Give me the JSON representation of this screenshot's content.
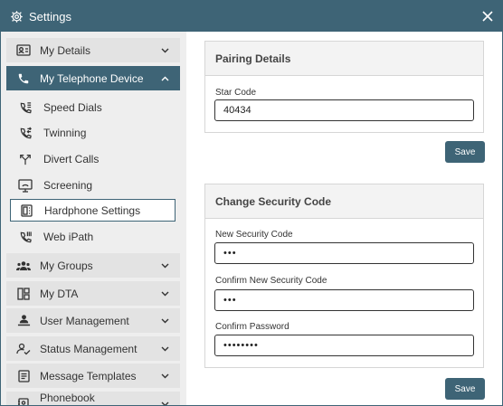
{
  "window": {
    "title": "Settings",
    "title_icon": "gear-icon",
    "close_icon": "close-icon"
  },
  "colors": {
    "accent": "#3e6476",
    "sidebar_bg": "#eeeeee",
    "nav_item_bg": "#e3e3e3",
    "panel_head_bg": "#f3f3f3"
  },
  "sidebar": {
    "my_details": {
      "label": "My Details",
      "icon": "id-card-icon"
    },
    "my_telephone_device": {
      "label": "My Telephone Device",
      "icon": "phone-icon"
    },
    "sub_items": [
      {
        "label": "Speed Dials",
        "icon": "speed-dial-icon"
      },
      {
        "label": "Twinning",
        "icon": "twinning-icon"
      },
      {
        "label": "Divert Calls",
        "icon": "divert-icon"
      },
      {
        "label": "Screening",
        "icon": "screening-icon"
      },
      {
        "label": "Hardphone Settings",
        "icon": "hardphone-icon"
      },
      {
        "label": "Web iPath",
        "icon": "web-ipath-icon"
      }
    ],
    "my_groups": {
      "label": "My Groups",
      "icon": "groups-icon"
    },
    "my_dta": {
      "label": "My DTA",
      "icon": "dta-icon"
    },
    "user_management": {
      "label": "User Management",
      "icon": "user-management-icon"
    },
    "status_management": {
      "label": "Status Management",
      "icon": "status-management-icon"
    },
    "message_templates": {
      "label": "Message Templates",
      "icon": "message-templates-icon"
    },
    "phonebook_management": {
      "label": "Phonebook Management",
      "icon": "phonebook-icon"
    }
  },
  "pairing": {
    "heading": "Pairing Details",
    "star_code_label": "Star Code",
    "star_code_value": "40434",
    "save_label": "Save"
  },
  "security": {
    "heading": "Change Security Code",
    "new_code_label": "New Security Code",
    "new_code_value": "•••",
    "confirm_code_label": "Confirm New Security Code",
    "confirm_code_value": "•••",
    "confirm_password_label": "Confirm Password",
    "confirm_password_value": "••••••••",
    "save_label": "Save"
  }
}
